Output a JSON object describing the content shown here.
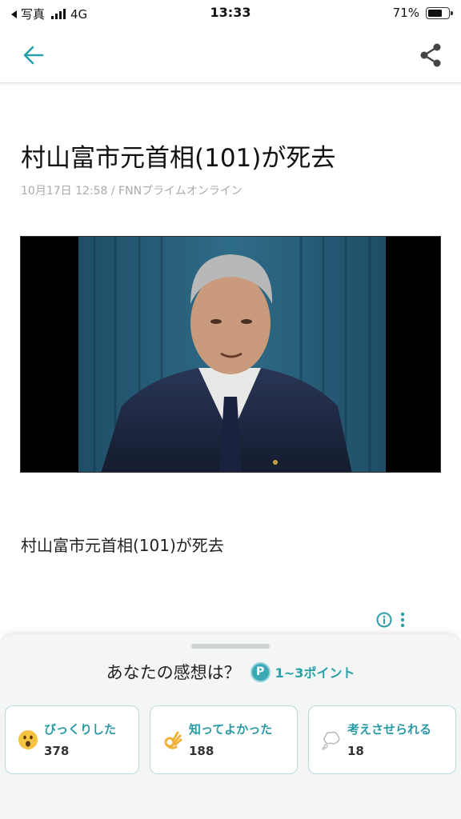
{
  "status_bar": {
    "back_app": "写真",
    "network": "4G",
    "time": "13:33",
    "battery_percent": "71%",
    "battery_level": 0.71
  },
  "nav": {
    "back_icon": "arrow-left-icon",
    "share_icon": "share-icon",
    "accent_color": "#2aa0ab"
  },
  "article": {
    "title": "村山富市元首相(101)が死去",
    "meta": "10月17日 12:58 / FNNプライムオンライン",
    "image_icon": "news-photo",
    "body": "村山富市元首相(101)が死去"
  },
  "ad": {
    "info_icon": "info-icon",
    "menu_icon": "more-vertical-icon"
  },
  "reaction_sheet": {
    "question": "あなたの感想は？",
    "point_icon_letter": "P",
    "points": "1~3ポイント",
    "reactions": [
      {
        "icon": "surprised-face-icon",
        "label": "びっくりした",
        "count": "378"
      },
      {
        "icon": "ok-hand-icon",
        "label": "知ってよかった",
        "count": "188"
      },
      {
        "icon": "thought-bubble-icon",
        "label": "考えさせられる",
        "count": "18"
      }
    ]
  }
}
